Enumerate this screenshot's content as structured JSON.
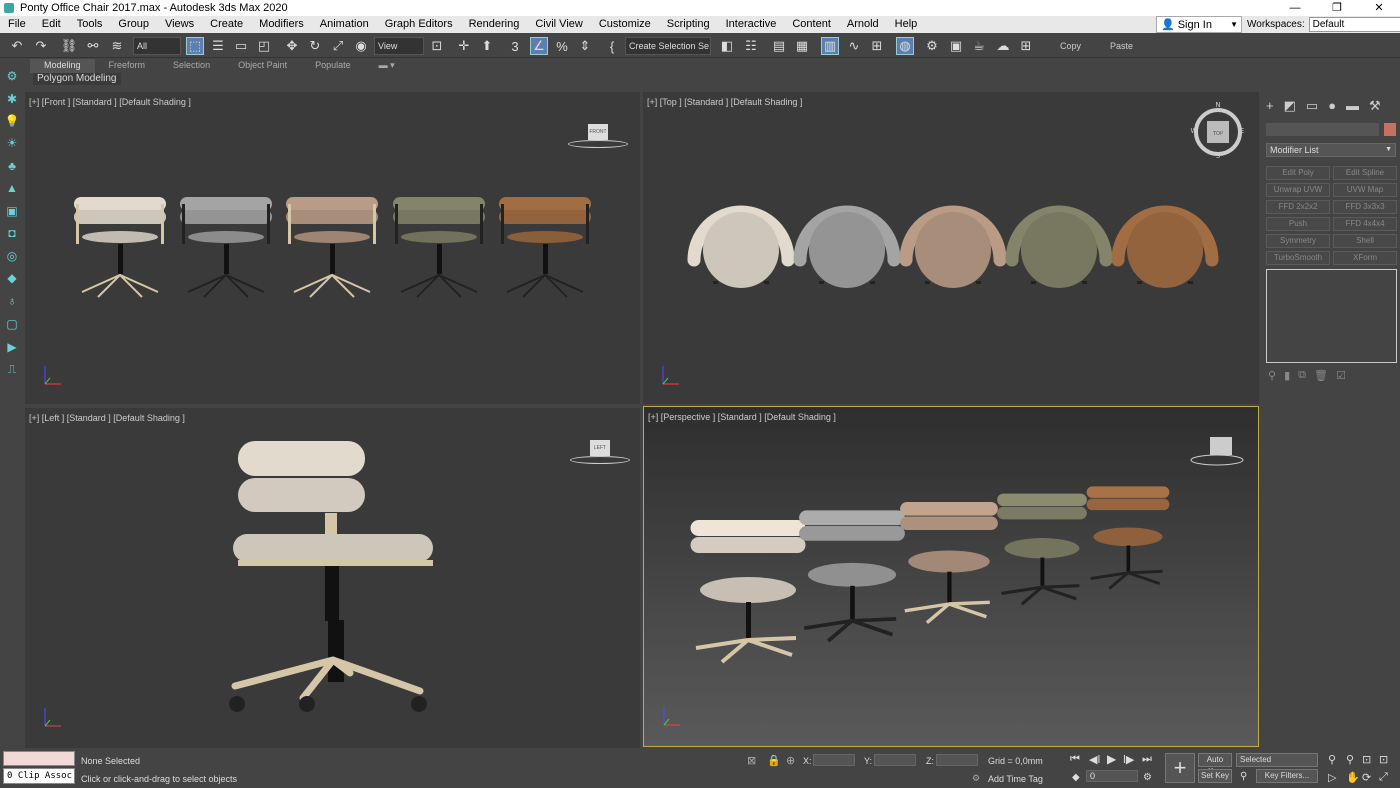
{
  "window": {
    "title": "Ponty Office Chair 2017.max - Autodesk 3ds Max 2020",
    "controls": [
      "—",
      "❐",
      "✕"
    ]
  },
  "menu": {
    "items": [
      "File",
      "Edit",
      "Tools",
      "Group",
      "Views",
      "Create",
      "Modifiers",
      "Animation",
      "Graph Editors",
      "Rendering",
      "Civil View",
      "Customize",
      "Scripting",
      "Interactive",
      "Content",
      "Arnold",
      "Help"
    ],
    "sign_in": "Sign In",
    "workspaces_label": "Workspaces:",
    "workspace_value": "Default"
  },
  "toolbar": {
    "filter_value": "All",
    "refcoord_value": "View",
    "selection_set_placeholder": "Create Selection Se",
    "copy_label": "Copy",
    "paste_label": "Paste"
  },
  "ribbon": {
    "tabs": [
      "Modeling",
      "Freeform",
      "Selection",
      "Object Paint",
      "Populate"
    ],
    "active_tab": "Modeling",
    "panel_label": "Polygon Modeling"
  },
  "viewports": {
    "front": {
      "label": "[+] [Front ] [Standard ] [Default Shading ]",
      "cube": "FRONT"
    },
    "top": {
      "label": "[+] [Top ] [Standard ] [Default Shading ]",
      "cube": "TOP",
      "compass": [
        "N",
        "E",
        "S",
        "W"
      ]
    },
    "left": {
      "label": "[+] [Left ] [Standard ] [Default Shading ]",
      "cube": "LEFT"
    },
    "perspective": {
      "label": "[+] [Perspective ] [Standard ] [Default Shading ]"
    }
  },
  "chair_colors": [
    "#d8d0c4",
    "#9c9c9c",
    "#b09480",
    "#7e7e66",
    "#9a6840"
  ],
  "command_panel": {
    "modifier_list": "Modifier List",
    "modifiers": [
      "Edit Poly",
      "Edit Spline",
      "Unwrap UVW",
      "UVW Map",
      "FFD 2x2x2",
      "FFD 3x3x3",
      "Push",
      "FFD 4x4x4",
      "Symmetry",
      "Shell",
      "TurboSmooth",
      "XForm"
    ]
  },
  "status": {
    "maxscript": "0 Clip Assoc",
    "selection": "None Selected",
    "prompt": "Click or click-and-drag to select objects",
    "x_label": "X:",
    "y_label": "Y:",
    "z_label": "Z:",
    "grid": "Grid = 0,0mm",
    "add_time_tag": "Add Time Tag",
    "auto_key": "Auto Key",
    "set_key": "Set Key",
    "selected_value": "Selected",
    "key_filters": "Key Filters...",
    "frame_value": "0"
  }
}
